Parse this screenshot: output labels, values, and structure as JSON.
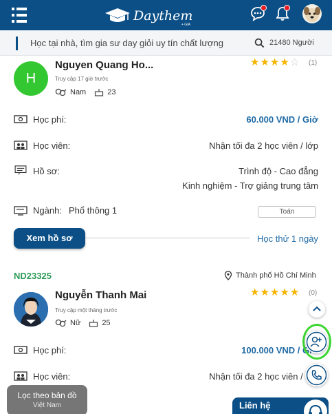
{
  "header": {
    "logo_text": "Daythem",
    "logo_sub": "+ GIA",
    "menu_icon": "hamburger-menu-icon",
    "chat_icon": "chat-icon",
    "bell_icon": "bell-icon",
    "badge_color": "#e51e25",
    "brand_color": "#0b4f86"
  },
  "search": {
    "tagline": "Học tại nhà, tìm gia sư day giỏi uy tín chất lượng",
    "count": "21480 Người"
  },
  "tutors": [
    {
      "initial": "H",
      "name": "Nguyen Quang Ho...",
      "access": "Truy cập 17 giờ trước",
      "gender": "Nam",
      "age": "23",
      "rating": 4,
      "rating_count": "(1)",
      "rows": {
        "fee_label": "Học phí:",
        "fee_value": "60.000 VND / Giờ",
        "students_label": "Học viên:",
        "students_value": "Nhận tối đa 2 học viên / lớp",
        "profile_label": "Hồ sơ:",
        "profile_line1": "Trình độ - Cao đẳng",
        "profile_line2": "Kinh nghiệm - Trợ giảng trung tâm",
        "major_label": "Ngành:",
        "major_value": "Phổ thông 1",
        "subject_chip": "Toán"
      },
      "view_profile": "Xem hồ sơ",
      "trial": "Học thử 1 ngày"
    },
    {
      "code": "ND23325",
      "location": "Thành phố Hồ Chí Minh",
      "name": "Nguyễn Thanh Mai",
      "access": "Truy cập một tháng trước",
      "gender": "Nữ",
      "age": "25",
      "rating": 5,
      "rating_count": "(0)",
      "rows": {
        "fee_label": "Học phí:",
        "fee_value": "100.000 VND / Giờ",
        "students_label": "Học viên:",
        "students_value": "Nhận tối đa 2 học viên / lớp"
      }
    }
  ],
  "floating": {
    "map_title": "Lọc theo bản đồ",
    "map_sub": "Việt Nam",
    "contact": "Liên hệ"
  }
}
